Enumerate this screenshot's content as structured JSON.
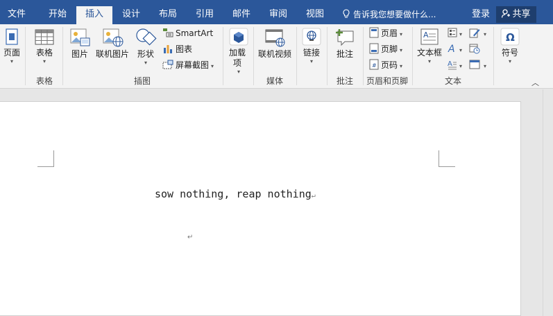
{
  "tabs": [
    {
      "label": "文件",
      "active": false
    },
    {
      "label": "开始",
      "active": false
    },
    {
      "label": "插入",
      "active": true
    },
    {
      "label": "设计",
      "active": false
    },
    {
      "label": "布局",
      "active": false
    },
    {
      "label": "引用",
      "active": false
    },
    {
      "label": "邮件",
      "active": false
    },
    {
      "label": "审阅",
      "active": false
    },
    {
      "label": "视图",
      "active": false
    }
  ],
  "tell_me": "告诉我您想要做什么...",
  "login": "登录",
  "share": "共享",
  "ribbon": {
    "pages": {
      "label": "页面"
    },
    "table": {
      "label": "表格",
      "group": "表格"
    },
    "illustrations": {
      "group": "插图",
      "picture": "图片",
      "online_picture": "联机图片",
      "shapes": "形状",
      "smartart": "SmartArt",
      "chart": "图表",
      "screenshot": "屏幕截图"
    },
    "addins": {
      "label": "加载项"
    },
    "media": {
      "group": "媒体",
      "online_video": "联机视频"
    },
    "links": {
      "label": "链接"
    },
    "comments": {
      "group": "批注",
      "comment": "批注"
    },
    "header_footer": {
      "group": "页眉和页脚",
      "header": "页眉",
      "footer": "页脚",
      "page_number": "页码"
    },
    "text": {
      "group": "文本",
      "textbox": "文本框"
    },
    "symbols": {
      "label": "符号"
    }
  },
  "document": {
    "line1": "sow nothing, reap nothing",
    "para_mark": "↵"
  },
  "colors": {
    "accent": "#2b579a",
    "ribbon_bg": "#f3f3f3"
  }
}
